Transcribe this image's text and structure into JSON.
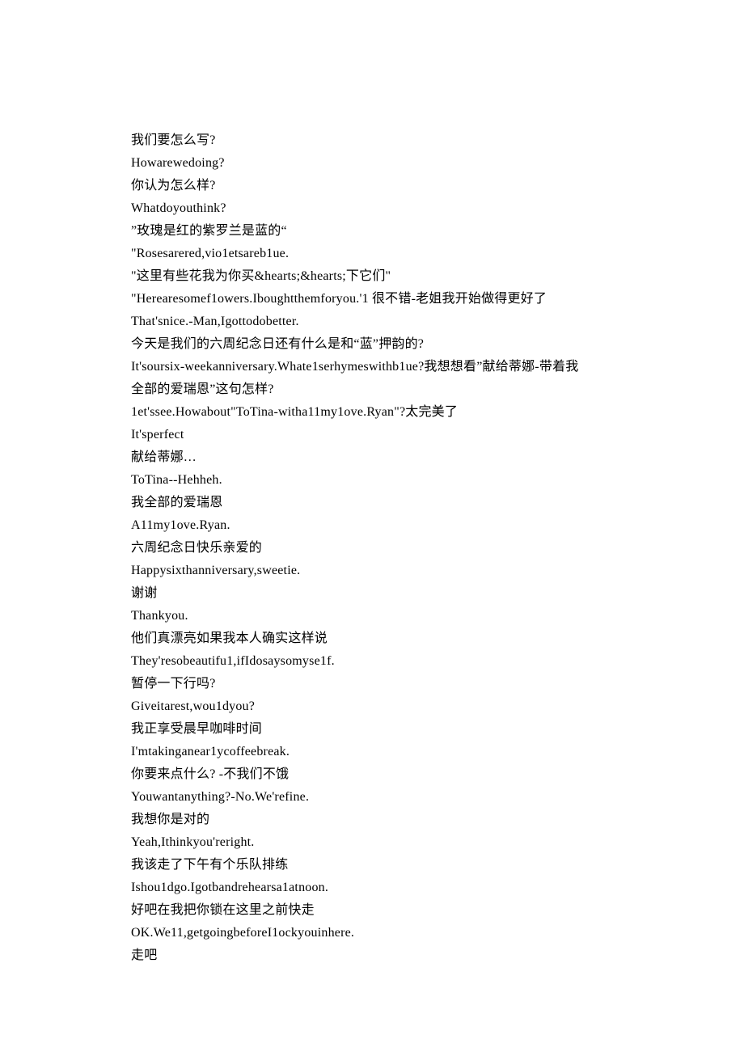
{
  "lines": [
    "我们要怎么写?",
    "Howarewedoing?",
    "你认为怎么样?",
    "Whatdoyouthink?",
    "”玫瑰是红的紫罗兰是蓝的“",
    "\"Rosesarered,vio1etsareb1ue.",
    "\"这里有些花我为你买&hearts;&hearts;下它们\"",
    "\"Herearesomef1owers.Iboughtthemforyou.'1 很不错-老姐我开始做得更好了",
    "That'snice.-Man,Igottodobetter.",
    "今天是我们的六周纪念日还有什么是和“蓝”押韵的?",
    "It'soursix-weekanniversary.Whate1serhymeswithb1ue?我想想看”献给蒂娜-带着我全部的爱瑞恩”这句怎样?",
    "1et'ssee.Howabout\"ToTina-witha11my1ove.Ryan\"?太完美了",
    "It'sperfect",
    "献给蒂娜…",
    "ToTina--Hehheh.",
    "我全部的爱瑞恩",
    "A11my1ove.Ryan.",
    "六周纪念日快乐亲爱的",
    "Happysixthanniversary,sweetie.",
    "谢谢",
    "Thankyou.",
    "他们真漂亮如果我本人确实这样说",
    "They'resobeautifu1,ifIdosaysomyse1f.",
    "暂停一下行吗?",
    "Giveitarest,wou1dyou?",
    "我正享受晨早咖啡时间",
    "I'mtakinganear1ycoffeebreak.",
    "你要来点什么? -不我们不饿",
    "Youwantanything?-No.We'refine.",
    "我想你是对的",
    "Yeah,Ithinkyou'reright.",
    "我该走了下午有个乐队排练",
    "Ishou1dgo.Igotbandrehearsa1atnoon.",
    "好吧在我把你锁在这里之前快走",
    "OK.We11,getgoingbeforeI1ockyouinhere.",
    "走吧"
  ]
}
